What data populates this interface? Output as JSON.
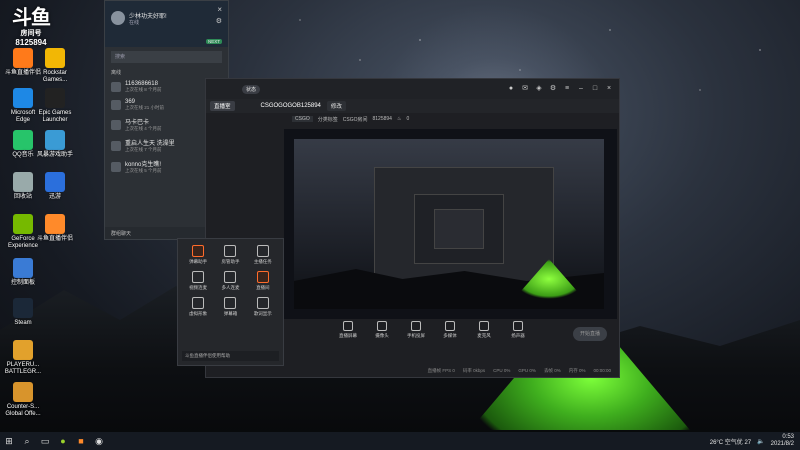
{
  "desktop": {
    "icons": [
      {
        "label": "此电脑",
        "color": "#3a7bd5"
      },
      {
        "label": "斗鱼直播伴侣",
        "color": "#ff7a1a"
      },
      {
        "label": "Rockstar Games...",
        "color": "#f2b705"
      },
      {
        "label": "Microsoft Edge",
        "color": "#1e88e5"
      },
      {
        "label": "Epic Games Launcher",
        "color": "#222"
      },
      {
        "label": "QQ音乐",
        "color": "#27c46a"
      },
      {
        "label": "风暴游戏助手",
        "color": "#3a9bd5"
      },
      {
        "label": "回收站",
        "color": "#9aa"
      },
      {
        "label": "迅游",
        "color": "#2b6fdc"
      },
      {
        "label": "GeForce Experience",
        "color": "#76b900"
      },
      {
        "label": "斗鱼直播伴侣",
        "color": "#ff8a2a"
      },
      {
        "label": "控制面板",
        "color": "#3a7bd5"
      },
      {
        "label": "Steam",
        "color": "#1b2838"
      },
      {
        "label": "PLAYERU... BATTLEGR...",
        "color": "#e2a12c"
      },
      {
        "label": "Counter-S... Global Offe...",
        "color": "#d8942c"
      }
    ],
    "watermark_room": "房间号",
    "watermark_id": "8125894"
  },
  "chat": {
    "username": "少林功夫好耶!",
    "status_text": "在线",
    "level_badge": "NEXT",
    "search_placeholder": "搜索",
    "section_online": "离线",
    "contacts": [
      {
        "name": "1163686618",
        "msg": "上次在线 8 个月前"
      },
      {
        "name": "369",
        "msg": "上次在线 21 小时前"
      },
      {
        "name": "马卡巴卡",
        "msg": "上次在线 4 个月前"
      },
      {
        "name": "重启人生天 洗澡里",
        "msg": "上次在线 7 个月前"
      },
      {
        "name": "konno克生瞧!",
        "msg": "上次在线 5 个月前"
      }
    ],
    "footer": "群组聊天"
  },
  "app": {
    "status_pill": "状态",
    "tab_live": "直播室",
    "room_title": "CSGOGOGOB125894",
    "edit_label": "修改",
    "category": "CSGO",
    "category2": "分类标签",
    "room_id_label": "CSGO房间",
    "room_id": "8125894",
    "fire_count": "0",
    "controls": [
      {
        "label": "直播屏幕",
        "icon": "screen-icon"
      },
      {
        "label": "摄像头",
        "icon": "camera-icon"
      },
      {
        "label": "手机投屏",
        "icon": "phone-icon"
      },
      {
        "label": "多媒体",
        "icon": "media-icon"
      },
      {
        "label": "麦克风",
        "icon": "mic-icon"
      },
      {
        "label": "扬声器",
        "icon": "speaker-icon"
      }
    ],
    "go_live": "开始直播",
    "stats": [
      "直播帧 FPS 0",
      "码率 0kbps",
      "CPU 0%",
      "GPU 0%",
      "丢帧 0%",
      "内存 0%",
      "00:00:00"
    ]
  },
  "tools": {
    "items": [
      {
        "label": "弹幕助手",
        "hl": true
      },
      {
        "label": "房管助手",
        "hl": false
      },
      {
        "label": "主播任务",
        "hl": false
      },
      {
        "label": "视频连麦",
        "hl": false
      },
      {
        "label": "多人连麦",
        "hl": false
      },
      {
        "label": "直播间",
        "hl": true
      },
      {
        "label": "虚拟形象",
        "hl": false
      },
      {
        "label": "弹幕箱",
        "hl": false
      },
      {
        "label": "歌词显示",
        "hl": false
      }
    ],
    "footer": "斗鱼直播伴侣使用帮助"
  },
  "taskbar": {
    "weather": "26°C 空气优 27",
    "time": "0:53",
    "date": "2021/8/2"
  }
}
